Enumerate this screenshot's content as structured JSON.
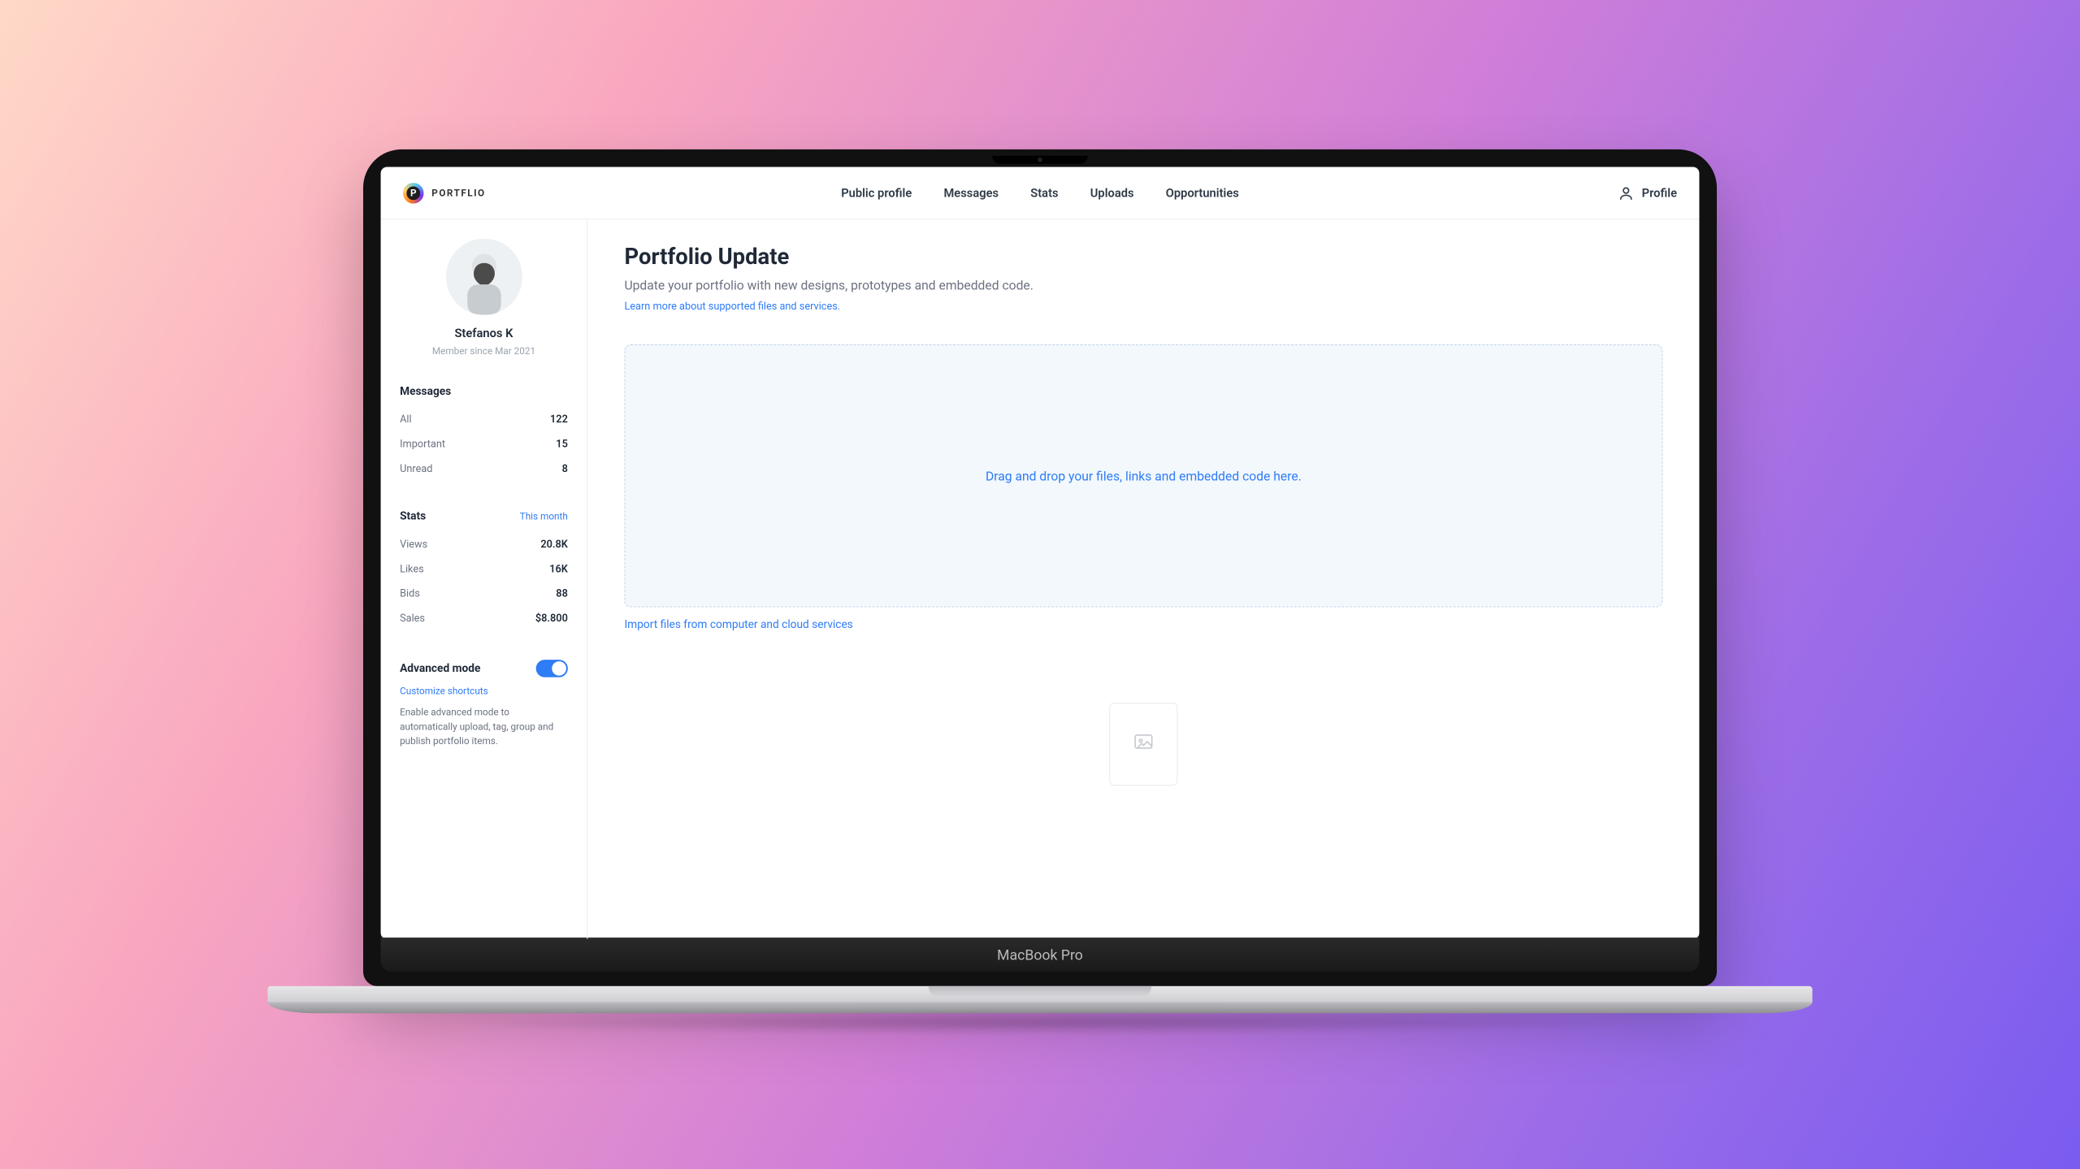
{
  "brand": {
    "logo_letter": "P",
    "name": "PORTFLIO"
  },
  "nav": {
    "links": [
      "Public profile",
      "Messages",
      "Stats",
      "Uploads",
      "Opportunities"
    ],
    "profile_label": "Profile"
  },
  "sidebar": {
    "user": {
      "name": "Stefanos K",
      "member_since": "Member since Mar 2021"
    },
    "messages": {
      "title": "Messages",
      "items": [
        {
          "label": "All",
          "value": "122"
        },
        {
          "label": "Important",
          "value": "15"
        },
        {
          "label": "Unread",
          "value": "8"
        }
      ]
    },
    "stats": {
      "title": "Stats",
      "period": "This month",
      "items": [
        {
          "label": "Views",
          "value": "20.8K"
        },
        {
          "label": "Likes",
          "value": "16K"
        },
        {
          "label": "Bids",
          "value": "88"
        },
        {
          "label": "Sales",
          "value": "$8.800"
        }
      ]
    },
    "advanced": {
      "title": "Advanced mode",
      "customize": "Customize shortcuts",
      "description": "Enable advanced mode to automatically upload, tag, group and publish portfolio items.",
      "enabled": true
    }
  },
  "main": {
    "title": "Portfolio Update",
    "subtitle": "Update your portfolio with new designs, prototypes and embedded code.",
    "learn_more": "Learn more about supported files and services.",
    "dropzone_text": "Drag and drop your files, links and embedded code here.",
    "import_link": "Import files from computer and cloud services"
  },
  "device": {
    "label": "MacBook Pro"
  }
}
